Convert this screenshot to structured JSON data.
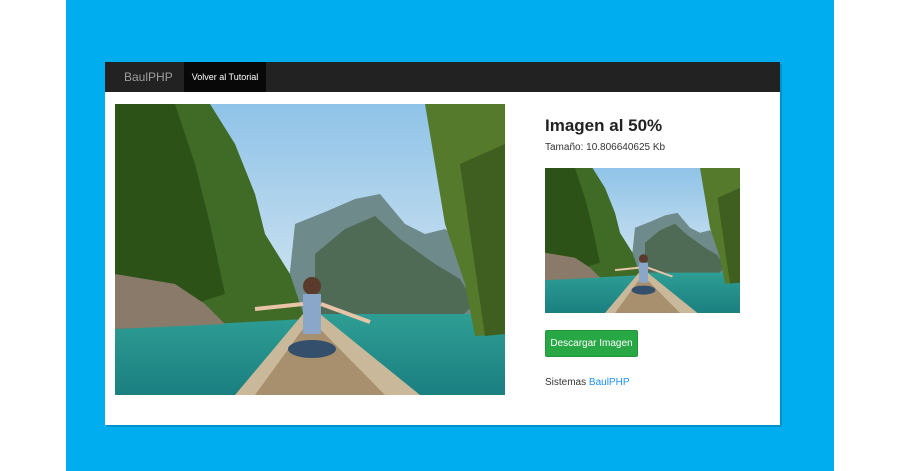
{
  "colors": {
    "background": "#00adef",
    "navbar": "#222222",
    "active_nav": "#080808",
    "button": "#28a745",
    "link": "#1e90ff"
  },
  "navbar": {
    "brand": "BaulPHP",
    "back_link": "Volver al Tutorial"
  },
  "content": {
    "title": "Imagen al 50%",
    "size_label": "Tamaño:",
    "size_value": "10.806640625 Kb",
    "download_button": "Descargar Imagen",
    "footer_prefix": "Sistemas",
    "footer_link": "BaulPHP"
  },
  "images": {
    "original_icon": "photo-woman-on-boat-lagoon",
    "thumbnail_icon": "photo-woman-on-boat-lagoon-small"
  }
}
